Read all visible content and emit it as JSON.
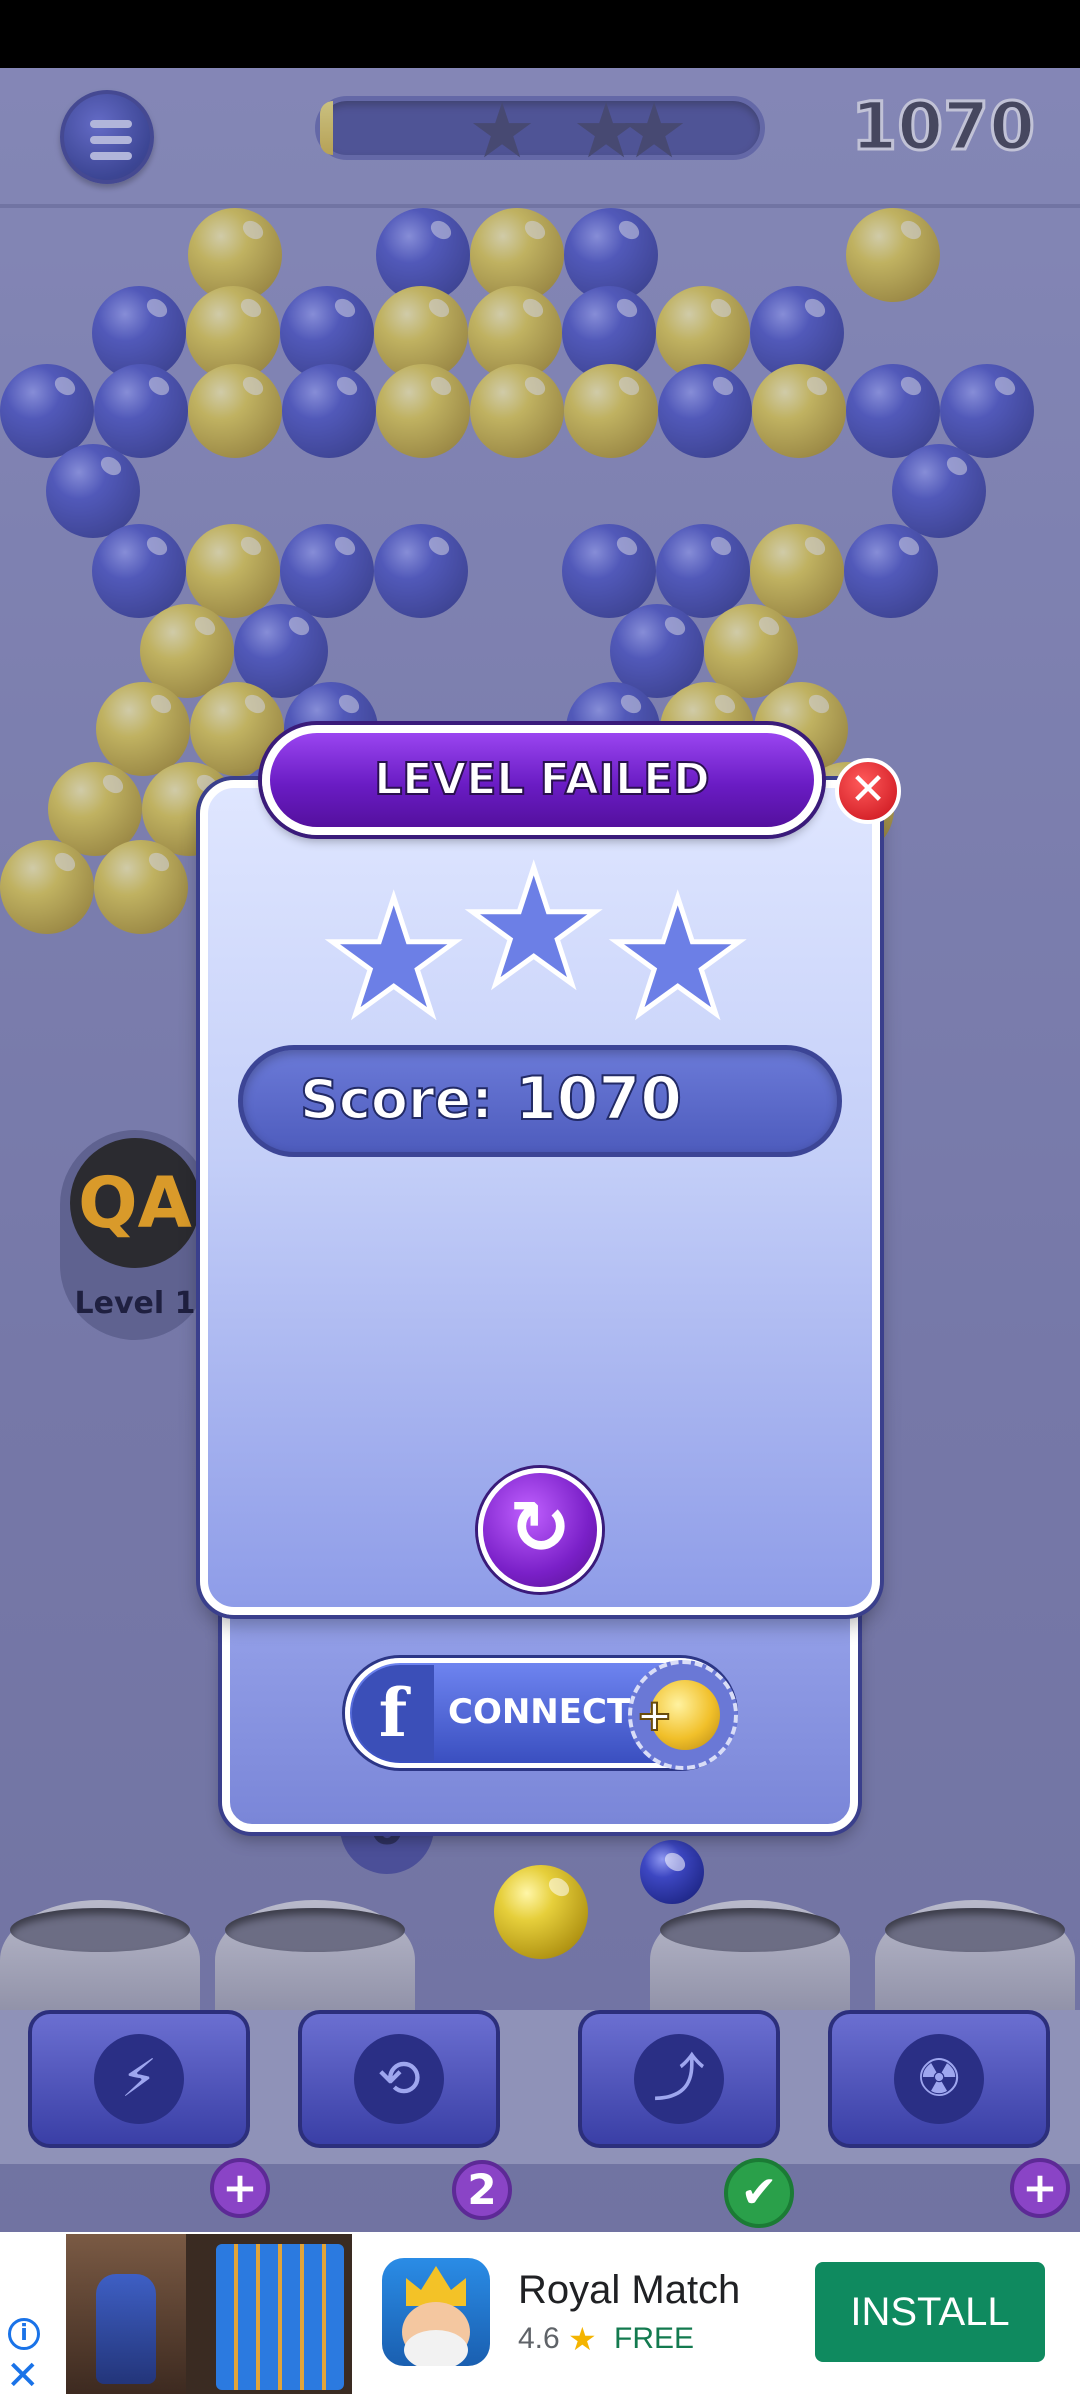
{
  "hud": {
    "score": "1070",
    "progress_fraction": 0.03,
    "stars_earned": 0
  },
  "player": {
    "avatar_text": "QA",
    "level_label": "Level 1"
  },
  "dialog": {
    "title": "LEVEL FAILED",
    "close_glyph": "✕",
    "score_label": "Score:",
    "score_value": "1070",
    "stars_earned": 0,
    "retry_glyph": "↻",
    "facebook_glyph": "f",
    "connect_label": "CONNECT",
    "coin_plus": "+"
  },
  "shooter": {
    "remaining_count": "0"
  },
  "boosters": [
    {
      "name": "lightning-booster",
      "icon": "lightning-icon",
      "glyph": "⚡",
      "badge": "+"
    },
    {
      "name": "swap-booster",
      "icon": "swap-icon",
      "glyph": "⟲",
      "badge": "2"
    },
    {
      "name": "aim-booster",
      "icon": "aim-icon",
      "glyph": "⤴",
      "badge": "✔"
    },
    {
      "name": "bomb-booster",
      "icon": "radiation-icon",
      "glyph": "☢",
      "badge": "+"
    }
  ],
  "ad": {
    "title": "Royal Match",
    "rating": "4.6",
    "star_glyph": "★",
    "price": "FREE",
    "install_label": "INSTALL",
    "info_glyph": "i",
    "close_glyph": "✕"
  },
  "colors": {
    "bubble_yellow": "#d9c231",
    "bubble_blue": "#2a3399",
    "title_purple": "#6a1cc4",
    "install_green": "#0f8a5f"
  }
}
